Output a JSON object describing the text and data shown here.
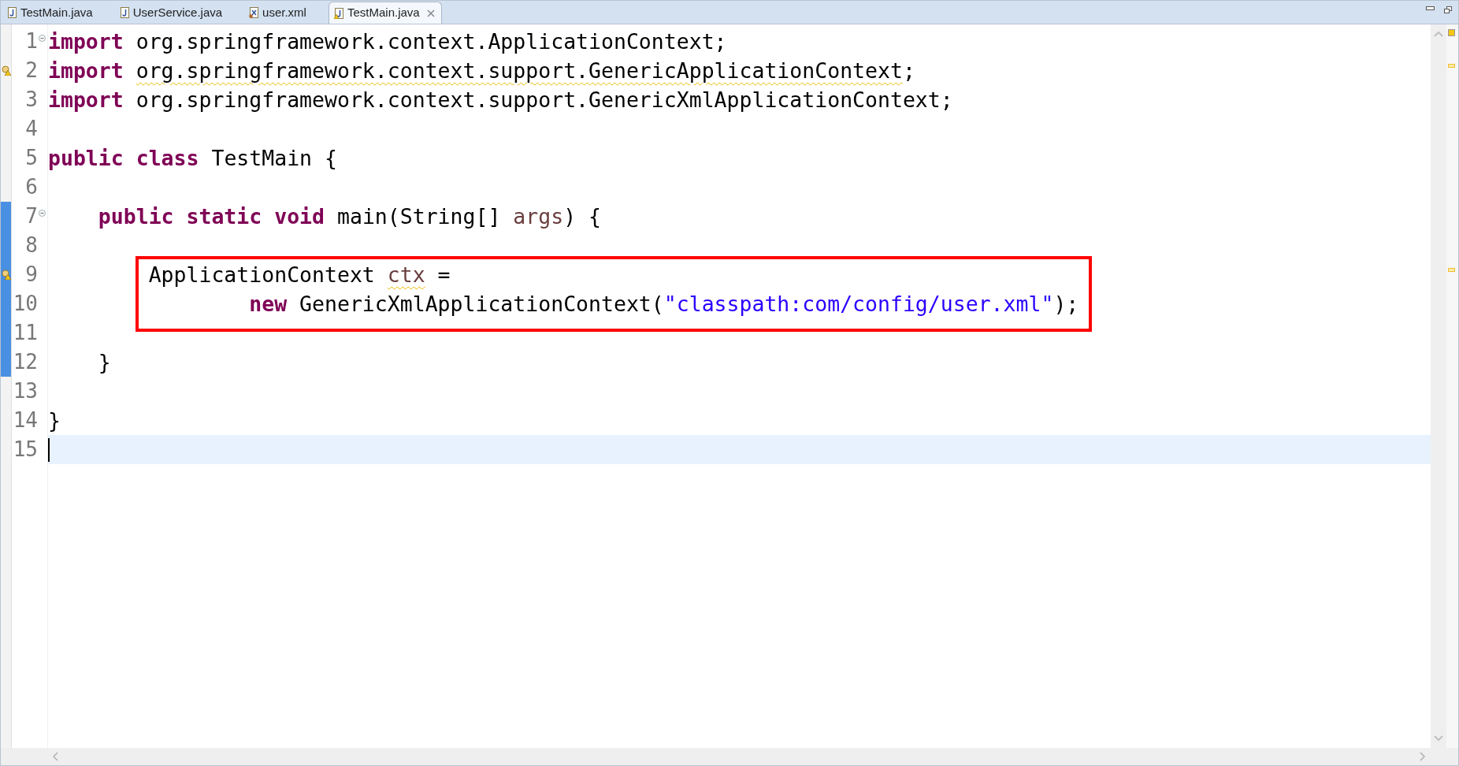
{
  "tabs": [
    {
      "label": "TestMain.java",
      "kind": "java",
      "selected": false,
      "warning": false
    },
    {
      "label": "UserService.java",
      "kind": "java",
      "selected": false,
      "warning": false
    },
    {
      "label": "user.xml",
      "kind": "xml",
      "selected": false,
      "warning": false
    },
    {
      "label": "TestMain.java",
      "kind": "java",
      "selected": true,
      "warning": true
    }
  ],
  "lines": [
    {
      "number": "1",
      "fold": true,
      "marker": false,
      "changed": false,
      "current": false,
      "tokens": [
        {
          "kind": "keyword",
          "text": "import"
        },
        {
          "kind": "plain",
          "text": " org.springframework.context.ApplicationContext;"
        }
      ]
    },
    {
      "number": "2",
      "fold": false,
      "marker": true,
      "changed": false,
      "current": false,
      "tokens": [
        {
          "kind": "keyword",
          "text": "import "
        },
        {
          "kind": "plain",
          "text": "org.springframework.context.support.GenericApplicationContext",
          "warning": true
        },
        {
          "kind": "plain",
          "text": ";"
        }
      ]
    },
    {
      "number": "3",
      "fold": false,
      "marker": false,
      "changed": false,
      "current": false,
      "tokens": [
        {
          "kind": "keyword",
          "text": "import"
        },
        {
          "kind": "plain",
          "text": " org.springframework.context.support.GenericXmlApplicationContext;"
        }
      ]
    },
    {
      "number": "4",
      "fold": false,
      "marker": false,
      "changed": false,
      "current": false
    },
    {
      "number": "5",
      "fold": false,
      "marker": false,
      "changed": false,
      "current": false,
      "tokens": [
        {
          "kind": "keyword",
          "text": "public "
        },
        {
          "kind": "keyword",
          "text": "class"
        },
        {
          "kind": "plain",
          "text": " TestMain {"
        }
      ]
    },
    {
      "number": "6",
      "fold": false,
      "marker": false,
      "changed": false,
      "current": false
    },
    {
      "number": "7",
      "fold": true,
      "marker": false,
      "changed": true,
      "current": false,
      "tokens": [
        {
          "kind": "keyword",
          "text": "    public "
        },
        {
          "kind": "keyword",
          "text": "static "
        },
        {
          "kind": "keyword",
          "text": "void"
        },
        {
          "kind": "plain",
          "text": " main(String[] "
        },
        {
          "kind": "variable",
          "text": "args"
        },
        {
          "kind": "plain",
          "text": ") {"
        }
      ]
    },
    {
      "number": "8",
      "fold": false,
      "marker": false,
      "changed": true,
      "current": false
    },
    {
      "number": "9",
      "fold": false,
      "marker": true,
      "changed": true,
      "current": false,
      "tokens": [
        {
          "kind": "plain",
          "text": "        ApplicationContext "
        },
        {
          "kind": "variable",
          "text": "ctx",
          "warning": true
        },
        {
          "kind": "plain",
          "text": " ="
        }
      ]
    },
    {
      "number": "10",
      "fold": false,
      "marker": false,
      "changed": true,
      "current": false,
      "tokens": [
        {
          "kind": "keyword",
          "text": "                new"
        },
        {
          "kind": "plain",
          "text": " GenericXmlApplicationContext("
        },
        {
          "kind": "string",
          "text": "\"classpath:com/config/user.xml\""
        },
        {
          "kind": "plain",
          "text": ");"
        }
      ]
    },
    {
      "number": "11",
      "fold": false,
      "marker": false,
      "changed": true,
      "current": false
    },
    {
      "number": "12",
      "fold": false,
      "marker": false,
      "changed": true,
      "current": false,
      "tokens": [
        {
          "kind": "plain",
          "text": "    }"
        }
      ]
    },
    {
      "number": "13",
      "fold": false,
      "marker": false,
      "changed": false,
      "current": false
    },
    {
      "number": "14",
      "fold": false,
      "marker": false,
      "changed": false,
      "current": false,
      "tokens": [
        {
          "kind": "plain",
          "text": "}"
        }
      ]
    },
    {
      "number": "15",
      "fold": false,
      "marker": false,
      "changed": false,
      "current": true
    }
  ]
}
